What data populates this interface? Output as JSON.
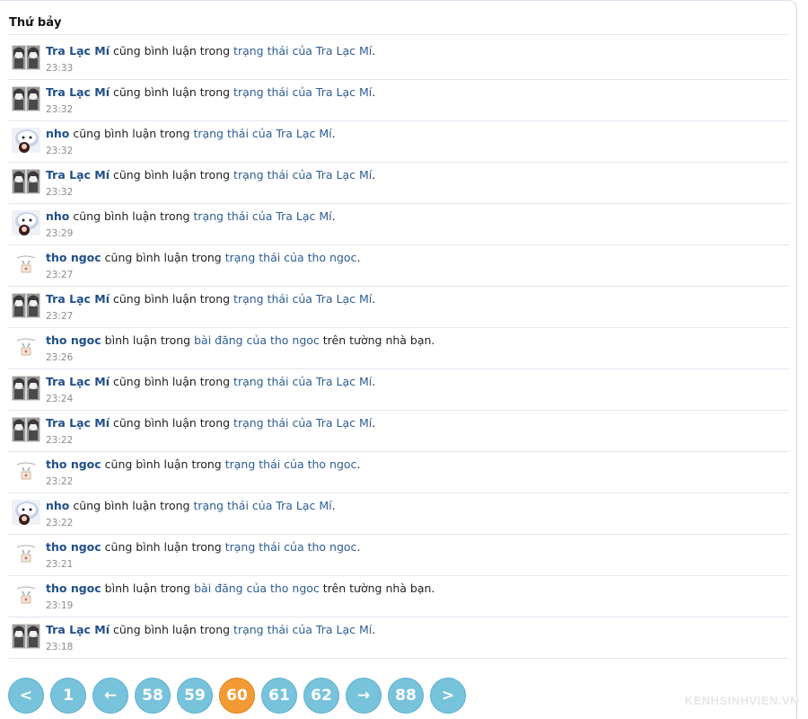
{
  "day_heading": "Thứ bảy",
  "verb_commented_also": "cũng bình luận trong",
  "verb_commented": "bình luận trong",
  "feed": [
    {
      "avatar": "tra",
      "user": "Tra Lạc Mí",
      "verb": "cũng bình luận trong",
      "link": "trạng thái của Tra Lạc Mí",
      "tail": ".",
      "time": "23:33"
    },
    {
      "avatar": "tra",
      "user": "Tra Lạc Mí",
      "verb": "cũng bình luận trong",
      "link": "trạng thái của Tra Lạc Mí",
      "tail": ".",
      "time": "23:32"
    },
    {
      "avatar": "nho",
      "user": "nho",
      "verb": "cũng bình luận trong",
      "link": "trạng thái của Tra Lạc Mí",
      "tail": ".",
      "time": "23:32"
    },
    {
      "avatar": "tra",
      "user": "Tra Lạc Mí",
      "verb": "cũng bình luận trong",
      "link": "trạng thái của Tra Lạc Mí",
      "tail": ".",
      "time": "23:32"
    },
    {
      "avatar": "nho",
      "user": "nho",
      "verb": "cũng bình luận trong",
      "link": "trạng thái của Tra Lạc Mí",
      "tail": ".",
      "time": "23:29"
    },
    {
      "avatar": "tho",
      "user": "tho ngoc",
      "verb": "cũng bình luận trong",
      "link": "trạng thái của tho ngoc",
      "tail": ".",
      "time": "23:27"
    },
    {
      "avatar": "tra",
      "user": "Tra Lạc Mí",
      "verb": "cũng bình luận trong",
      "link": "trạng thái của Tra Lạc Mí",
      "tail": ".",
      "time": "23:27"
    },
    {
      "avatar": "tho",
      "user": "tho ngoc",
      "verb": "bình luận trong",
      "link": "bài đăng của tho ngoc",
      "tail": " trên tường nhà bạn.",
      "time": "23:26"
    },
    {
      "avatar": "tra",
      "user": "Tra Lạc Mí",
      "verb": "cũng bình luận trong",
      "link": "trạng thái của Tra Lạc Mí",
      "tail": ".",
      "time": "23:24"
    },
    {
      "avatar": "tra",
      "user": "Tra Lạc Mí",
      "verb": "cũng bình luận trong",
      "link": "trạng thái của Tra Lạc Mí",
      "tail": ".",
      "time": "23:22"
    },
    {
      "avatar": "tho",
      "user": "tho ngoc",
      "verb": "cũng bình luận trong",
      "link": "trạng thái của tho ngoc",
      "tail": ".",
      "time": "23:22"
    },
    {
      "avatar": "nho",
      "user": "nho",
      "verb": "cũng bình luận trong",
      "link": "trạng thái của Tra Lạc Mí",
      "tail": ".",
      "time": "23:22"
    },
    {
      "avatar": "tho",
      "user": "tho ngoc",
      "verb": "cũng bình luận trong",
      "link": "trạng thái của tho ngoc",
      "tail": ".",
      "time": "23:21"
    },
    {
      "avatar": "tho",
      "user": "tho ngoc",
      "verb": "bình luận trong",
      "link": "bài đăng của tho ngoc",
      "tail": " trên tường nhà bạn.",
      "time": "23:19"
    },
    {
      "avatar": "tra",
      "user": "Tra Lạc Mí",
      "verb": "cũng bình luận trong",
      "link": "trạng thái của Tra Lạc Mí",
      "tail": ".",
      "time": "23:18"
    }
  ],
  "pagination": [
    {
      "label": "<",
      "name": "prev-page-button",
      "current": false
    },
    {
      "label": "1",
      "name": "page-1-button",
      "current": false
    },
    {
      "label": "←",
      "name": "page-jump-back-button",
      "current": false
    },
    {
      "label": "58",
      "name": "page-58-button",
      "current": false
    },
    {
      "label": "59",
      "name": "page-59-button",
      "current": false
    },
    {
      "label": "60",
      "name": "page-60-button",
      "current": true
    },
    {
      "label": "61",
      "name": "page-61-button",
      "current": false
    },
    {
      "label": "62",
      "name": "page-62-button",
      "current": false
    },
    {
      "label": "→",
      "name": "page-jump-forward-button",
      "current": false
    },
    {
      "label": "88",
      "name": "page-88-button",
      "current": false
    },
    {
      "label": ">",
      "name": "next-page-button",
      "current": false
    }
  ],
  "colors": {
    "page_button": "#78c3dc",
    "current_page_button": "#f39a35",
    "user_link": "#1f4e8a"
  },
  "watermark": "KENHSINHVIEN.VN"
}
